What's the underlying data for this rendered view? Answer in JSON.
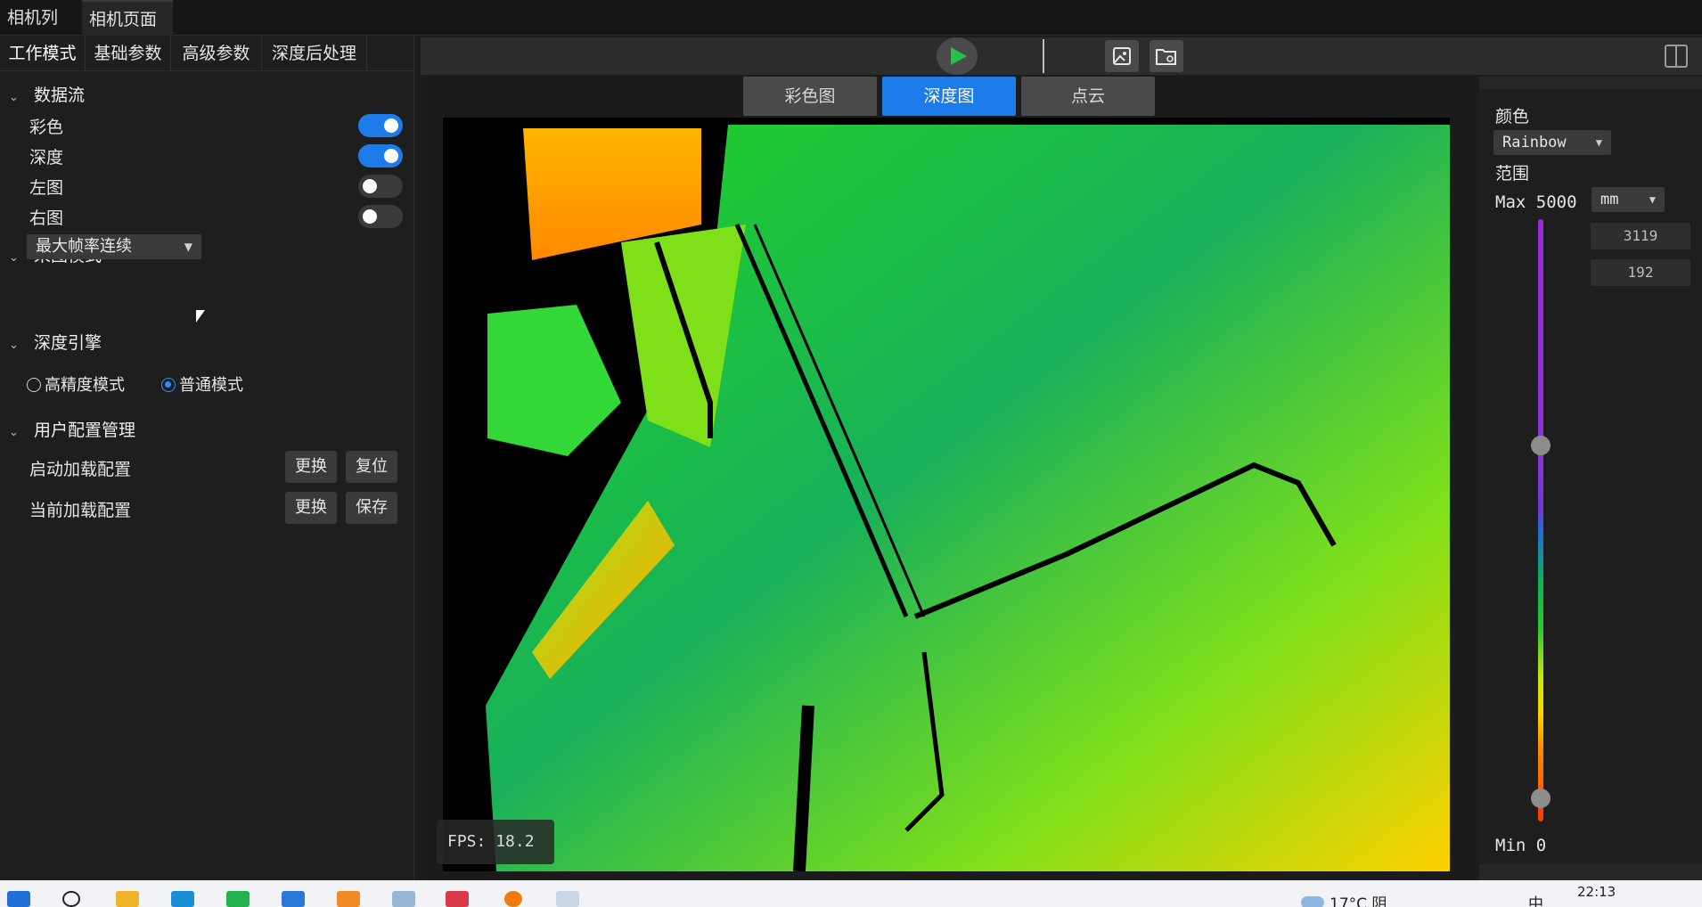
{
  "top_tabs": [
    "相机列表",
    "相机页面"
  ],
  "param_tabs": [
    "工作模式",
    "基础参数",
    "高级参数",
    "深度后处理"
  ],
  "data_stream": {
    "title": "数据流",
    "items": [
      {
        "label": "彩色",
        "on": true
      },
      {
        "label": "深度",
        "on": true
      },
      {
        "label": "左图",
        "on": false
      },
      {
        "label": "右图",
        "on": false
      }
    ]
  },
  "capture_mode": {
    "title": "采图模式",
    "selected": "最大帧率连续"
  },
  "depth_engine": {
    "title": "深度引擎",
    "options": [
      "高精度模式",
      "普通模式"
    ],
    "selected": "普通模式"
  },
  "user_config": {
    "title": "用户配置管理",
    "rows": [
      {
        "label": "启动加载配置",
        "buttons": [
          "更换",
          "复位"
        ]
      },
      {
        "label": "当前加载配置",
        "buttons": [
          "更换",
          "保存"
        ]
      }
    ]
  },
  "view_tabs": [
    "彩色图",
    "深度图",
    "点云"
  ],
  "active_view": "深度图",
  "fps": {
    "label": "FPS:",
    "value": "18.2"
  },
  "right_panel": {
    "color_label": "颜色",
    "colormap": "Rainbow",
    "range_label": "范围",
    "max_label": "Max",
    "max_value": "5000",
    "unit": "mm",
    "upper_value": "3119",
    "lower_value": "192",
    "min_label": "Min",
    "min_value": "0"
  },
  "taskbar": {
    "weather": "17°C 阴",
    "ime": "中",
    "clock": "22:13"
  },
  "colors": {
    "accent": "#1e7bea",
    "play": "#22c34a"
  }
}
